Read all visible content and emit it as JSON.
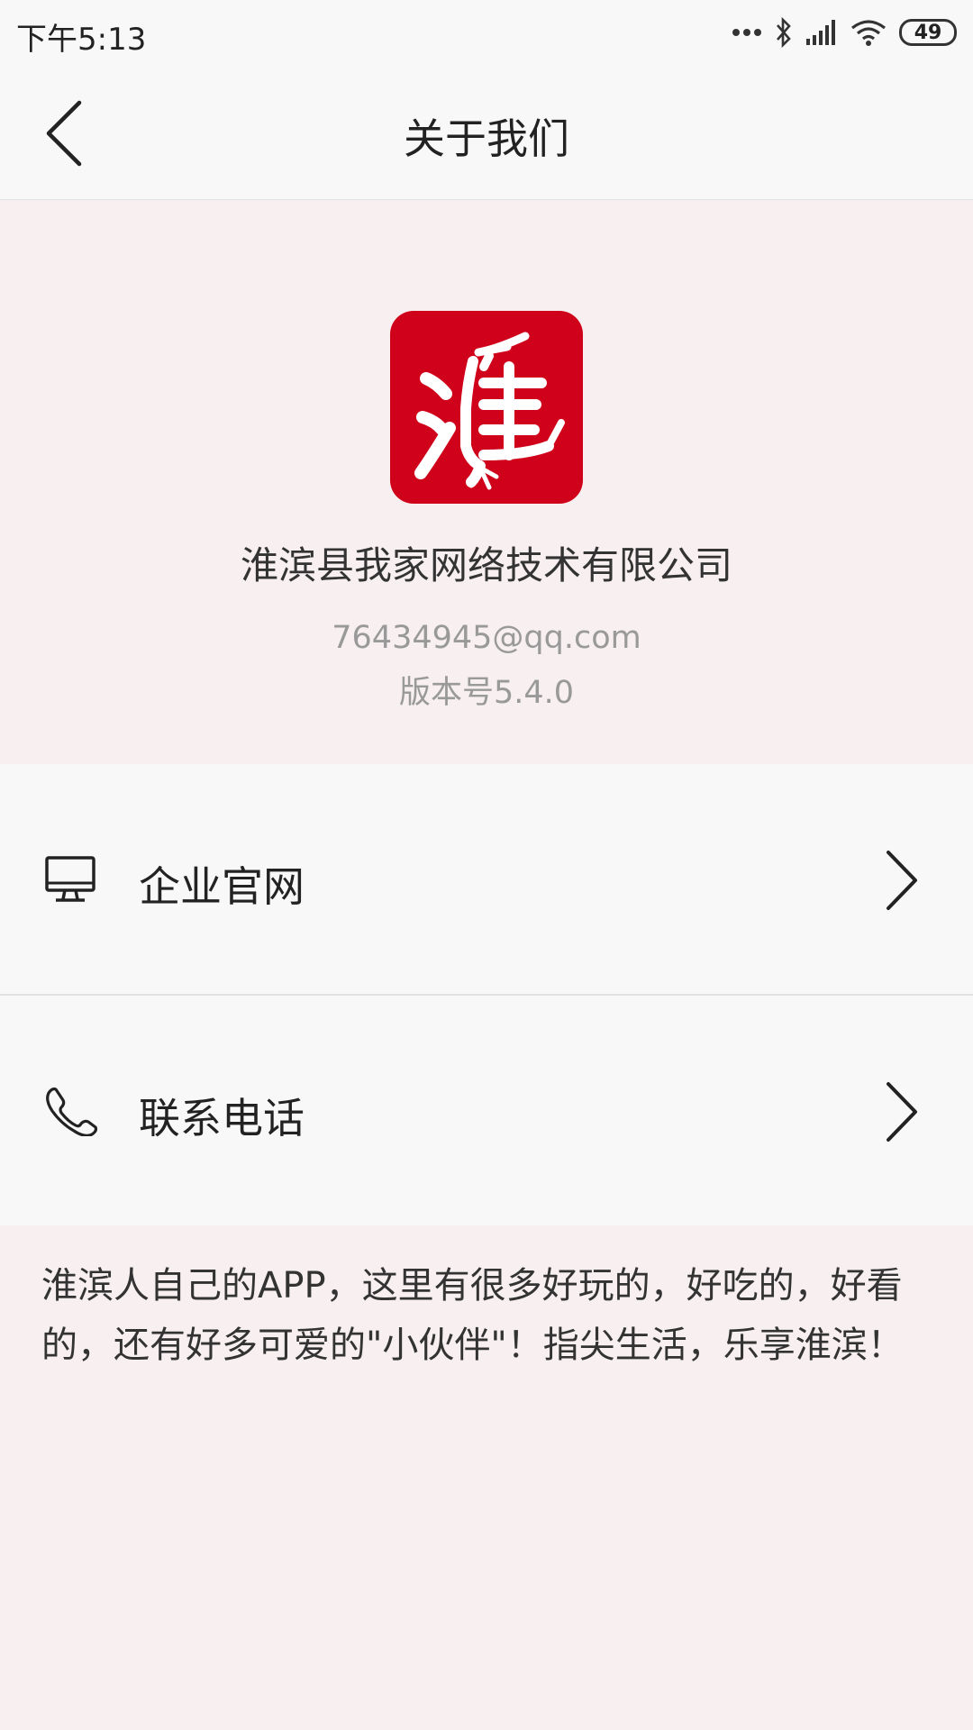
{
  "status_bar": {
    "time": "下午5:13",
    "battery": "49",
    "icons": [
      "more-dots-icon",
      "bluetooth-icon",
      "signal-icon",
      "wifi-icon",
      "battery-icon"
    ]
  },
  "nav": {
    "title": "关于我们",
    "back_icon": "back-arrow-icon"
  },
  "about": {
    "logo_char": "淮",
    "logo_color": "#d0021b",
    "company_name": "淮滨县我家网络技术有限公司",
    "email": "76434945@qq.com",
    "version": "版本号5.4.0"
  },
  "menu": {
    "items": [
      {
        "label": "企业官网",
        "icon": "monitor-icon"
      },
      {
        "label": "联系电话",
        "icon": "phone-icon"
      }
    ]
  },
  "description": "淮滨人自己的APP，这里有很多好玩的，好吃的，好看的，还有好多可爱的\"小伙伴\"！指尖生活，乐享淮滨！",
  "colors": {
    "background": "#f8f8f8",
    "section_bg": "#f7eff0",
    "brand_red": "#d0021b",
    "secondary_text": "#999999"
  }
}
